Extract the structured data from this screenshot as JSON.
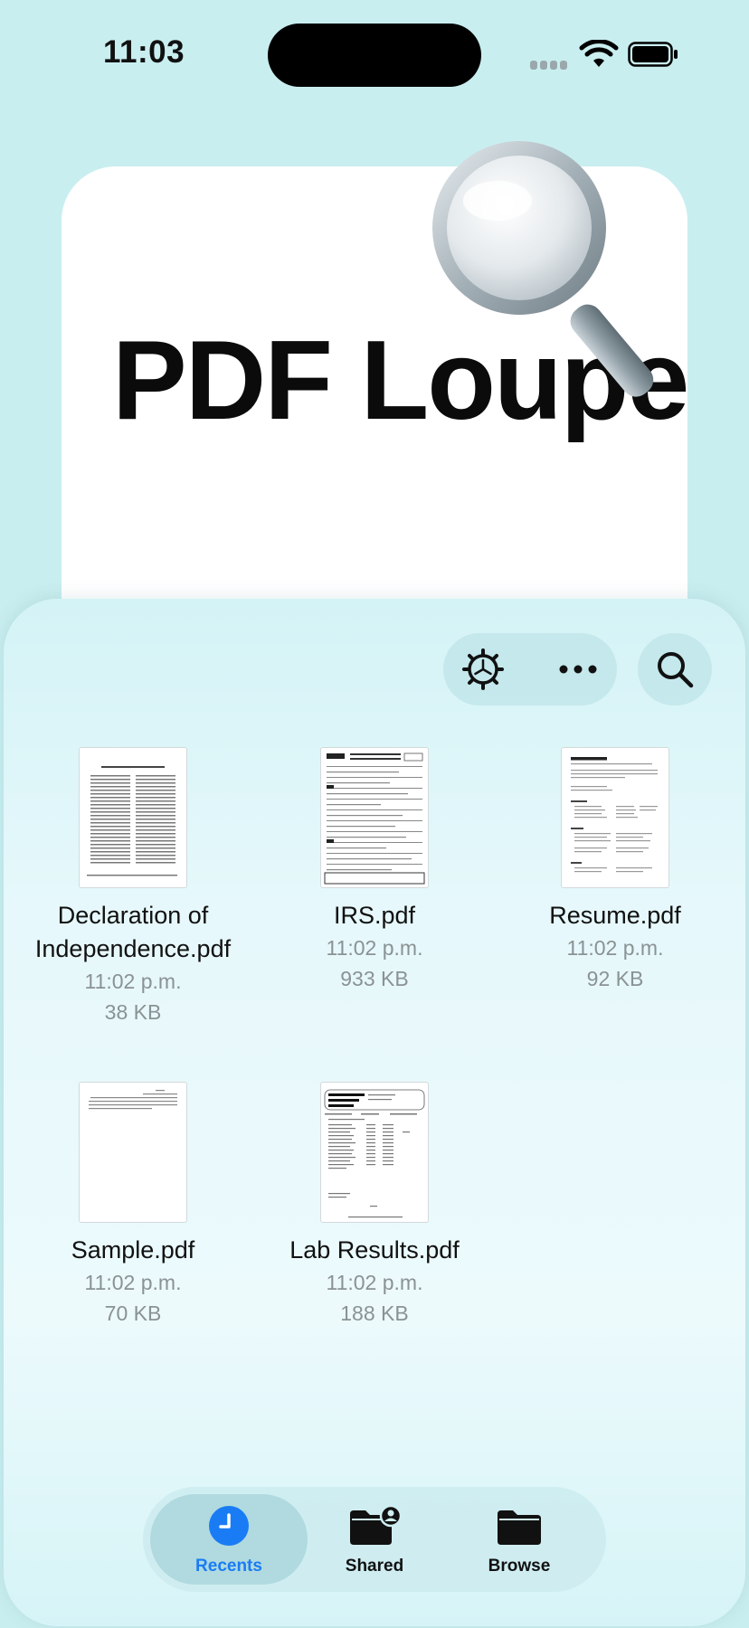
{
  "status_bar": {
    "time": "11:03"
  },
  "app": {
    "title": "PDF Loupe"
  },
  "toolbar": {
    "settings_icon": "gear-icon",
    "more_icon": "ellipsis-icon",
    "search_icon": "search-icon"
  },
  "files": [
    {
      "name": "Declaration of Independence.pdf",
      "time": "11:02 p.m.",
      "size": "38 KB"
    },
    {
      "name": "IRS.pdf",
      "time": "11:02 p.m.",
      "size": "933 KB"
    },
    {
      "name": "Resume.pdf",
      "time": "11:02 p.m.",
      "size": "92 KB"
    },
    {
      "name": "Sample.pdf",
      "time": "11:02 p.m.",
      "size": "70 KB"
    },
    {
      "name": "Lab Results.pdf",
      "time": "11:02 p.m.",
      "size": "188 KB"
    }
  ],
  "tabs": [
    {
      "label": "Recents",
      "icon": "clock-icon",
      "active": true
    },
    {
      "label": "Shared",
      "icon": "shared-folder-icon",
      "active": false
    },
    {
      "label": "Browse",
      "icon": "folder-icon",
      "active": false
    }
  ],
  "colors": {
    "accent": "#1a7cf5",
    "background": "#c9eef0",
    "meta_text": "#8a9294"
  }
}
